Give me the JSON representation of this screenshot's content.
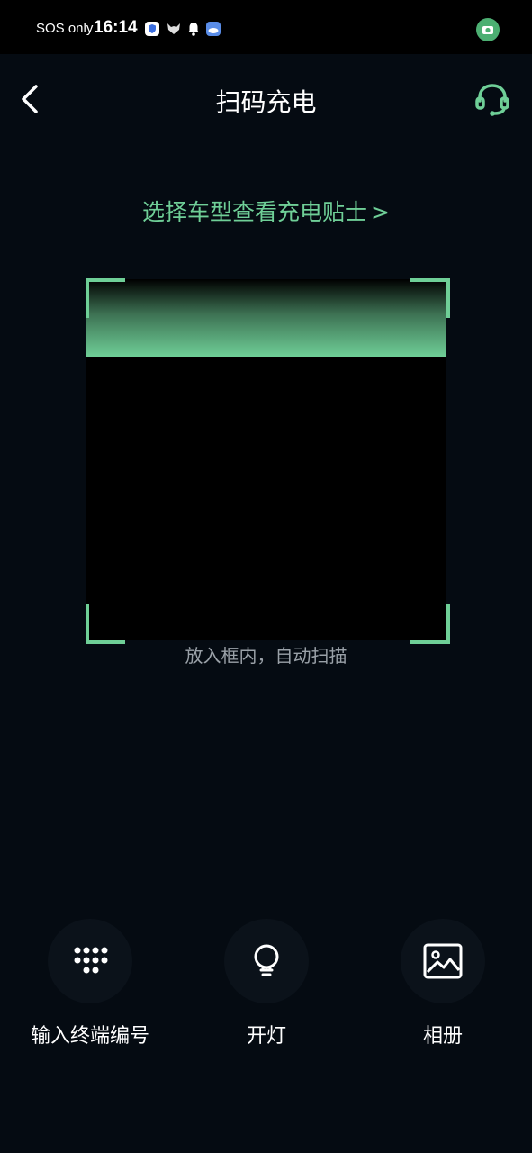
{
  "status_bar": {
    "carrier": "SOS only",
    "time": "16:14"
  },
  "header": {
    "title": "扫码充电"
  },
  "tip": {
    "label": "选择车型查看充电贴士",
    "chevron": ">"
  },
  "scanner": {
    "hint": "放入框内，自动扫描"
  },
  "actions": [
    {
      "label": "输入终端编号",
      "icon": "keypad-icon"
    },
    {
      "label": "开灯",
      "icon": "lightbulb-icon"
    },
    {
      "label": "相册",
      "icon": "gallery-icon"
    }
  ],
  "colors": {
    "accent": "#6fcf97",
    "background": "#050b12",
    "scan_area": "#000000"
  }
}
